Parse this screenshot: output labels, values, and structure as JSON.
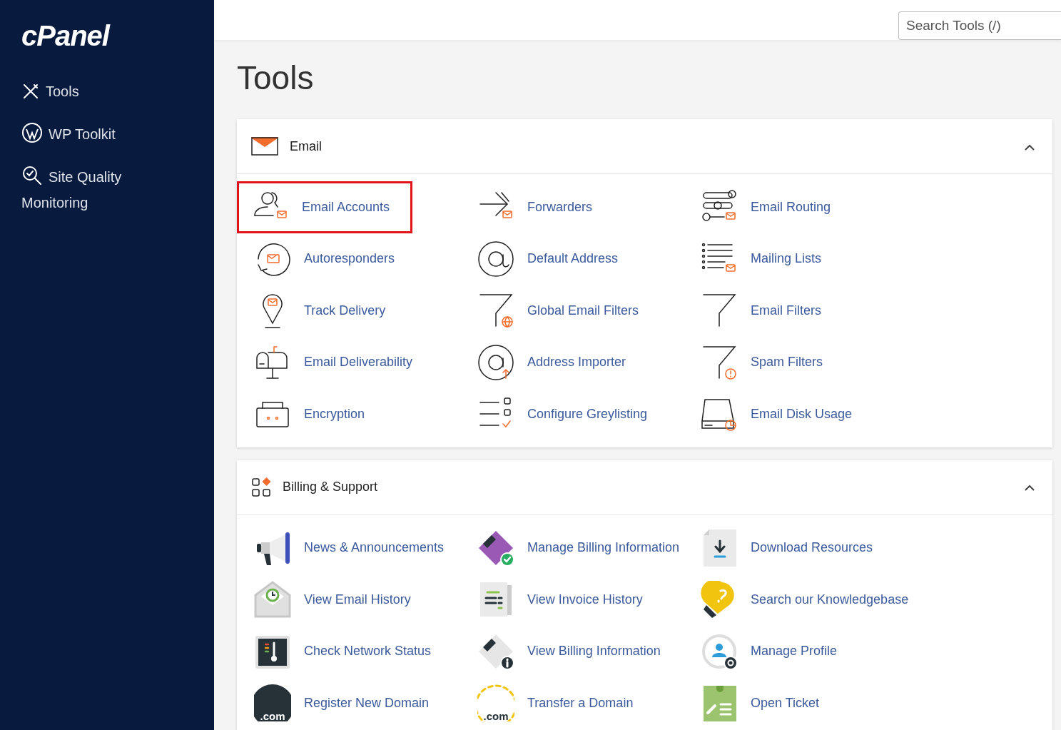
{
  "sidebar": {
    "logo": "cPanel",
    "items": [
      {
        "label": "Tools"
      },
      {
        "label": "WP Toolkit"
      },
      {
        "label": "Site Quality Monitoring"
      }
    ]
  },
  "header": {
    "search": {
      "placeholder": "Search Tools (/)"
    }
  },
  "page_title": "Tools",
  "sections": [
    {
      "title": "Email",
      "expanded": true,
      "items": [
        {
          "label": "Email Accounts",
          "selected": true
        },
        {
          "label": "Forwarders",
          "selected": false
        },
        {
          "label": "Email Routing",
          "selected": false
        },
        {
          "label": "Autoresponders",
          "selected": false
        },
        {
          "label": "Default Address",
          "selected": false
        },
        {
          "label": "Mailing Lists",
          "selected": false
        },
        {
          "label": "Track Delivery",
          "selected": false
        },
        {
          "label": "Global Email Filters",
          "selected": false
        },
        {
          "label": "Email Filters",
          "selected": false
        },
        {
          "label": "Email Deliverability",
          "selected": false
        },
        {
          "label": "Address Importer",
          "selected": false
        },
        {
          "label": "Spam Filters",
          "selected": false
        },
        {
          "label": "Encryption",
          "selected": false
        },
        {
          "label": "Configure Greylisting",
          "selected": false
        },
        {
          "label": "Email Disk Usage",
          "selected": false
        }
      ]
    },
    {
      "title": "Billing & Support",
      "expanded": true,
      "items": [
        {
          "label": "News & Announcements",
          "selected": false
        },
        {
          "label": "Manage Billing Information",
          "selected": false
        },
        {
          "label": "Download Resources",
          "selected": false
        },
        {
          "label": "View Email History",
          "selected": false
        },
        {
          "label": "View Invoice History",
          "selected": false
        },
        {
          "label": "Search our Knowledgebase",
          "selected": false
        },
        {
          "label": "Check Network Status",
          "selected": false
        },
        {
          "label": "View Billing Information",
          "selected": false
        },
        {
          "label": "Manage Profile",
          "selected": false
        },
        {
          "label": "Register New Domain",
          "selected": false,
          "icon_text": ".com"
        },
        {
          "label": "Transfer a Domain",
          "selected": false,
          "icon_text": ".com"
        },
        {
          "label": "Open Ticket",
          "selected": false
        }
      ]
    }
  ]
}
